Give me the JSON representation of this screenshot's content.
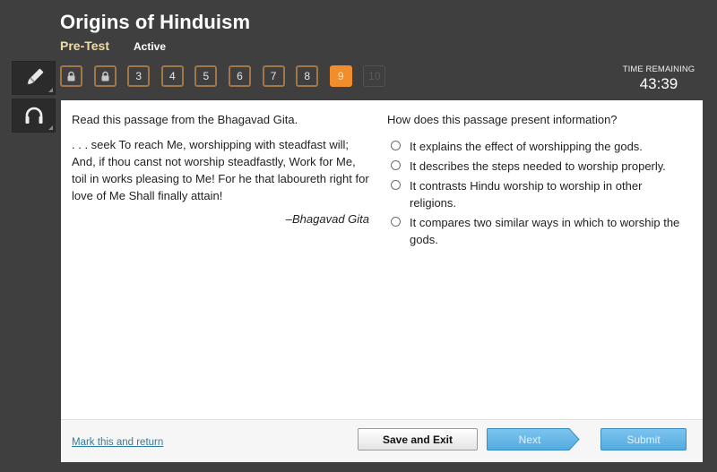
{
  "header": {
    "title": "Origins of Hinduism",
    "assessment_type": "Pre-Test",
    "status": "Active"
  },
  "tools": [
    {
      "name": "pencil",
      "icon": "pencil-icon"
    },
    {
      "name": "headphones",
      "icon": "headphones-icon"
    }
  ],
  "question_nav": [
    {
      "label": "",
      "state": "locked",
      "icon": "lock-icon"
    },
    {
      "label": "",
      "state": "locked",
      "icon": "lock-icon"
    },
    {
      "label": "3",
      "state": "default"
    },
    {
      "label": "4",
      "state": "default"
    },
    {
      "label": "5",
      "state": "default"
    },
    {
      "label": "6",
      "state": "default"
    },
    {
      "label": "7",
      "state": "default"
    },
    {
      "label": "8",
      "state": "default"
    },
    {
      "label": "9",
      "state": "current"
    },
    {
      "label": "10",
      "state": "disabled"
    }
  ],
  "timer": {
    "label": "TIME REMAINING",
    "value": "43:39"
  },
  "passage": {
    "instruction": "Read this passage from the Bhagavad Gita.",
    "text": ". . . seek To reach Me, worshipping with steadfast will; And, if thou canst not worship steadfastly, Work for Me, toil in works pleasing to Me! For he that laboureth right for love of Me Shall finally attain!",
    "attribution": "–Bhagavad Gita"
  },
  "question": {
    "prompt": "How does this passage present information?",
    "options": [
      {
        "text": "It explains the effect of worshipping the gods.",
        "selected": false
      },
      {
        "text": "It describes the steps needed to worship properly.",
        "selected": false
      },
      {
        "text": "It contrasts Hindu worship to worship in other religions.",
        "selected": false
      },
      {
        "text": "It compares two similar ways in which to worship the gods.",
        "selected": false
      }
    ]
  },
  "footer": {
    "mark_link": "Mark this and return",
    "save_exit": "Save and Exit",
    "next": "Next",
    "submit": "Submit"
  },
  "colors": {
    "background": "#3f3f3f",
    "accent_orange": "#f28d2b",
    "tile_border": "#a27748",
    "pretest_label": "#f1dca0",
    "button_blue": "#5db3e5",
    "link": "#2f7f9b"
  }
}
